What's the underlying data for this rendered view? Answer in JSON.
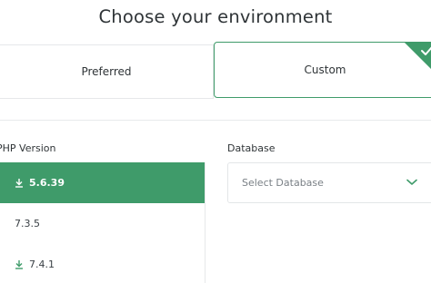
{
  "header": {
    "title": "Choose your environment"
  },
  "options": {
    "preferred_label": "Preferred",
    "custom_label": "Custom"
  },
  "php": {
    "label": "PHP Version",
    "versions": [
      {
        "label": "5.6.39",
        "selected": true,
        "icon": "download-icon"
      },
      {
        "label": "7.3.5",
        "selected": false,
        "icon": ""
      },
      {
        "label": "7.4.1",
        "selected": false,
        "icon": "download-icon"
      }
    ]
  },
  "database": {
    "label": "Database",
    "placeholder": "Select Database",
    "icon": "chevron-down-icon"
  },
  "colors": {
    "accent": "#3f9b6a",
    "text": "#2f3437",
    "muted": "#7a8086"
  }
}
